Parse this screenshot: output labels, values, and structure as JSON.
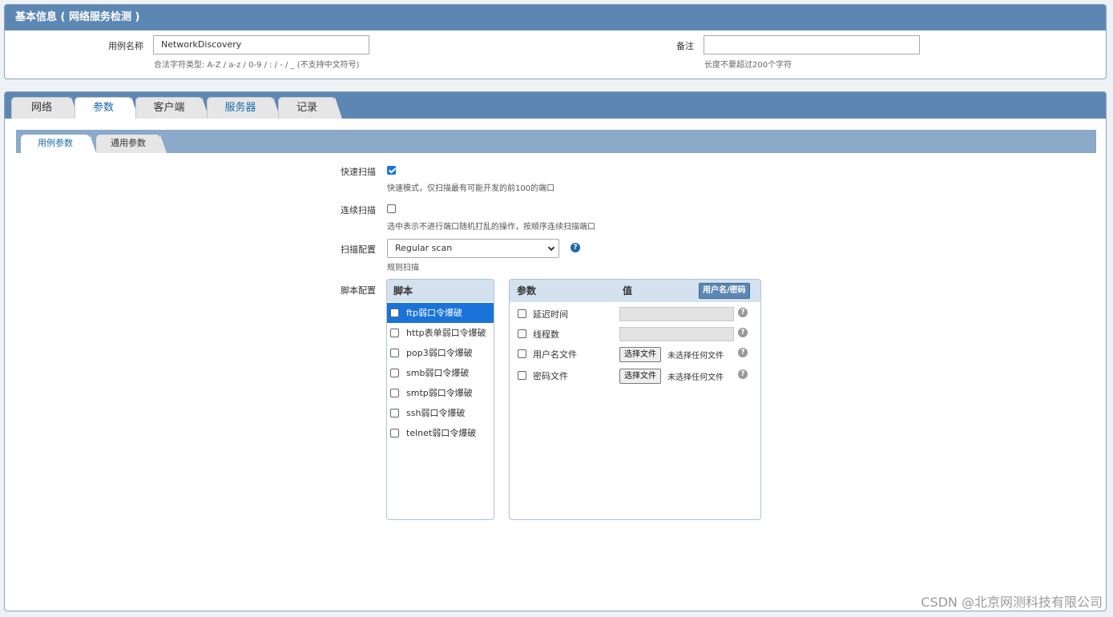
{
  "basic_info": {
    "title": "基本信息 ( 网络服务检测 )",
    "case_name_label": "用例名称",
    "case_name_value": "NetworkDiscovery",
    "case_name_hint": "合法字符类型: A-Z / a-z / 0-9 / : / - / _ (不支持中文符号)",
    "remark_label": "备注",
    "remark_value": "",
    "remark_hint": "长度不要超过200个字符"
  },
  "main_tabs": [
    {
      "label": "网络",
      "active": false
    },
    {
      "label": "参数",
      "active": true
    },
    {
      "label": "客户端",
      "active": false
    },
    {
      "label": "服务器",
      "active": false
    },
    {
      "label": "记录",
      "active": false
    }
  ],
  "sub_tabs": [
    {
      "label": "用例参数",
      "active": true
    },
    {
      "label": "通用参数",
      "active": false
    }
  ],
  "params": {
    "fast_scan_label": "快速扫描",
    "fast_scan_checked": true,
    "fast_scan_hint": "快速模式，仅扫描最有可能开发的前100的端口",
    "continuous_scan_label": "连续扫描",
    "continuous_scan_checked": false,
    "continuous_scan_hint": "选中表示不进行端口随机打乱的操作，按顺序连续扫描端口",
    "scan_config_label": "扫描配置",
    "scan_config_value": "Regular scan",
    "scan_config_hint": "规则扫描",
    "script_config_label": "脚本配置"
  },
  "scripts": {
    "header": "脚本",
    "items": [
      {
        "label": "ftp弱口令爆破",
        "checked": false,
        "selected": true
      },
      {
        "label": "http表单弱口令爆破",
        "checked": false,
        "selected": false
      },
      {
        "label": "pop3弱口令爆破",
        "checked": false,
        "selected": false
      },
      {
        "label": "smb弱口令爆破",
        "checked": false,
        "selected": false
      },
      {
        "label": "smtp弱口令爆破",
        "checked": false,
        "selected": false
      },
      {
        "label": "ssh弱口令爆破",
        "checked": false,
        "selected": false
      },
      {
        "label": "telnet弱口令爆破",
        "checked": false,
        "selected": false
      }
    ]
  },
  "script_params": {
    "header_param": "参数",
    "header_value": "值",
    "user_pass_button": "用户名/密码",
    "rows": [
      {
        "label": "延迟时间",
        "type": "text"
      },
      {
        "label": "线程数",
        "type": "text"
      },
      {
        "label": "用户名文件",
        "type": "file",
        "button": "选择文件",
        "file_text": "未选择任何文件"
      },
      {
        "label": "密码文件",
        "type": "file",
        "button": "选择文件",
        "file_text": "未选择任何文件"
      }
    ]
  },
  "watermark": "CSDN @北京网测科技有限公司",
  "colors": {
    "header_blue": "#5d87b3",
    "subtab_bar": "#8ba9c8",
    "selected_blue": "#1a73d9",
    "link_blue": "#1a6aad"
  }
}
